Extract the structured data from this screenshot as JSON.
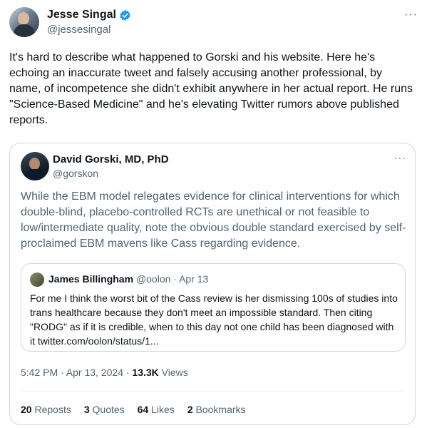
{
  "tweet": {
    "author_name": "Jesse Singal",
    "author_handle": "@jessesingal",
    "more_label": "···",
    "text": "It's hard to describe what happened to Gorski and his website. Here he's echoing an inaccurate tweet and falsely accusing another professional, by name, of incompetence she didn't exhibit anywhere in her actual report. He runs \"Science-Based Medicine\" and he's elevating Twitter rumors above published reports."
  },
  "quoted": {
    "author_name": "David Gorski, MD, PhD",
    "author_handle": "@gorskon",
    "more_label": "···",
    "text": "While the EBM model relegates evidence for clinical interventions for which double-blind, placebo-controlled RCTs are unethical or not feasible to low/intermediate quality, note the obvious double standard exercised by self-proclaimed EBM mavens like Cass regarding evidence.",
    "nested": {
      "author_name": "James Billingham",
      "meta": "@oolon · Apr 13",
      "text": "For me I think the worst bit of the Cass review is her dismissing 100s of studies into trans healthcare because they don't meet an impossible standard. Then citing \"RODG\" as if it is credible, when to this day not one child has been diagnosed with it twitter.com/oolon/status/1..."
    },
    "timestamp": "5:42 PM · Apr 13, 2024 · ",
    "views_count": "13.3K",
    "views_label": " Views",
    "stats": {
      "reposts_count": "20",
      "reposts_label": "Reposts",
      "quotes_count": "3",
      "quotes_label": "Quotes",
      "likes_count": "64",
      "likes_label": "Likes",
      "bookmarks_count": "2",
      "bookmarks_label": "Bookmarks"
    }
  },
  "colors": {
    "verified": "#1d9bf0",
    "secondary_text": "#536471",
    "border": "#cfd9de"
  },
  "icons": {
    "verified": "verified-badge-icon"
  }
}
